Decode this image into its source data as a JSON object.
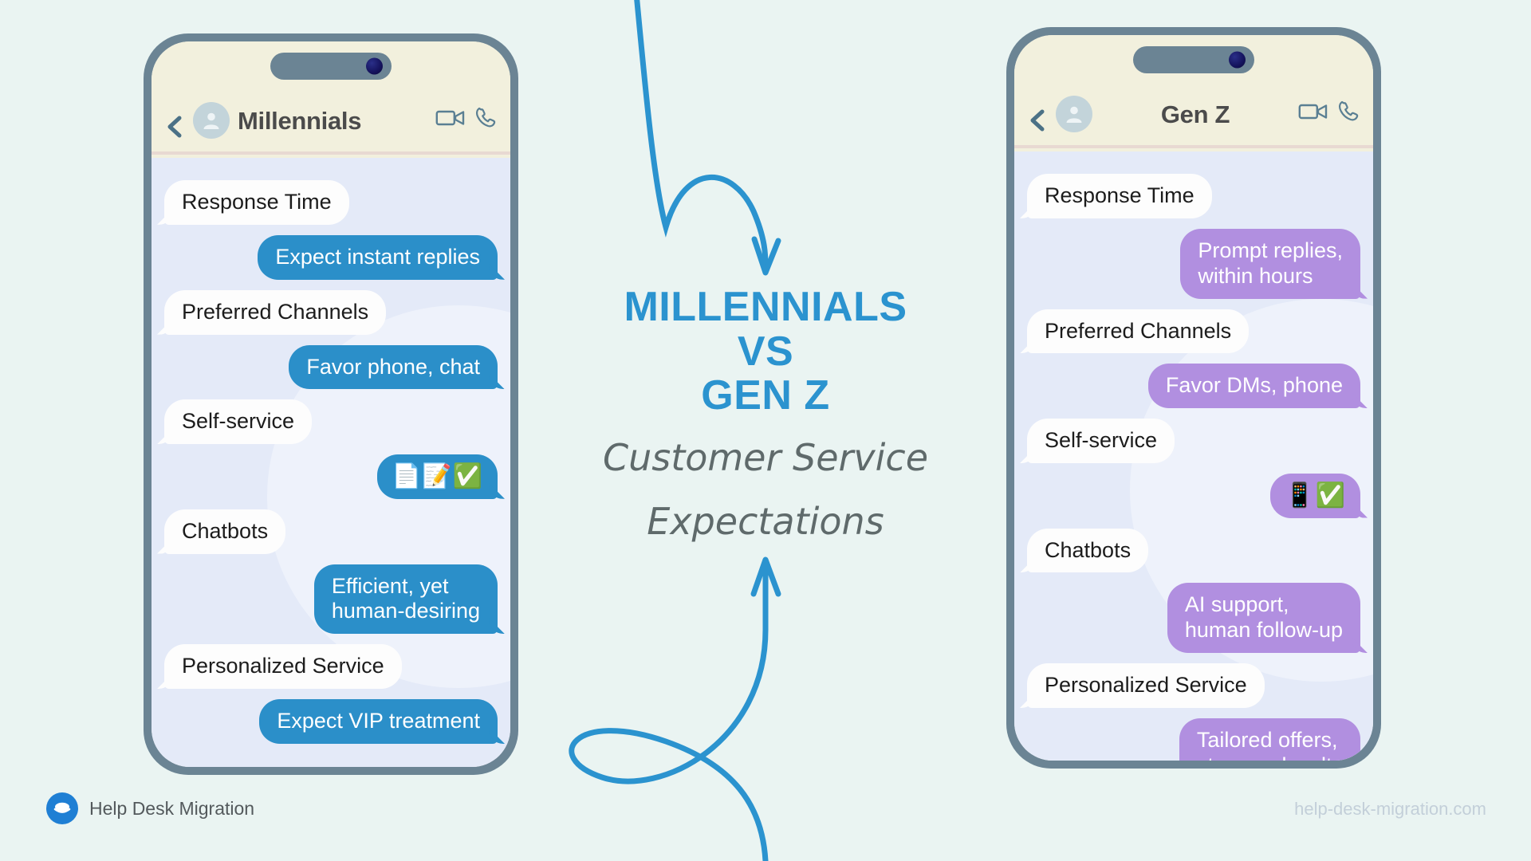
{
  "page": {
    "background_color": "#eaf4f2",
    "blue": "#2b8fc9",
    "purple": "#b18fe0"
  },
  "center": {
    "title_line1": "MILLENNIALS",
    "title_line2": "VS",
    "title_line3": "GEN Z",
    "subtitle_line1": "Customer Service",
    "subtitle_line2": "Expectations"
  },
  "phones": [
    {
      "id": "millennials",
      "header": {
        "back_icon": "chevron-left-icon",
        "avatar_icon": "person-avatar-icon",
        "title": "Millennials",
        "video_icon": "video-camera-icon",
        "call_icon": "phone-handset-icon"
      },
      "messages": [
        {
          "side": "left",
          "style": "white",
          "text": "Response Time"
        },
        {
          "side": "right",
          "style": "blue",
          "text": "Expect instant replies"
        },
        {
          "side": "left",
          "style": "white",
          "text": "Preferred Channels"
        },
        {
          "side": "right",
          "style": "blue",
          "text": "Favor phone, chat"
        },
        {
          "side": "left",
          "style": "white",
          "text": "Self-service"
        },
        {
          "side": "right",
          "style": "blue emoji",
          "text": "📄📝✅"
        },
        {
          "side": "left",
          "style": "white",
          "text": "Chatbots"
        },
        {
          "side": "right",
          "style": "blue",
          "text": "Efficient, yet\nhuman-desiring"
        },
        {
          "side": "left",
          "style": "white",
          "text": "Personalized Service"
        },
        {
          "side": "right",
          "style": "blue",
          "text": "Expect VIP treatment"
        }
      ]
    },
    {
      "id": "genz",
      "header": {
        "back_icon": "chevron-left-icon",
        "avatar_icon": "person-avatar-icon",
        "title": "Gen Z",
        "video_icon": "video-camera-icon",
        "call_icon": "phone-handset-icon"
      },
      "messages": [
        {
          "side": "left",
          "style": "white",
          "text": "Response Time"
        },
        {
          "side": "right",
          "style": "purple",
          "text": "Prompt replies,\nwithin hours"
        },
        {
          "side": "left",
          "style": "white",
          "text": "Preferred Channels"
        },
        {
          "side": "right",
          "style": "purple",
          "text": "Favor DMs, phone"
        },
        {
          "side": "left",
          "style": "white",
          "text": "Self-service"
        },
        {
          "side": "right",
          "style": "purple emoji",
          "text": "📱✅"
        },
        {
          "side": "left",
          "style": "white",
          "text": "Chatbots"
        },
        {
          "side": "right",
          "style": "purple",
          "text": "AI support,\nhuman follow-up"
        },
        {
          "side": "left",
          "style": "white",
          "text": "Personalized Service"
        },
        {
          "side": "right",
          "style": "purple",
          "text": "Tailored offers,\nstronger loyalty"
        }
      ]
    }
  ],
  "footer": {
    "brand": "Help Desk Migration",
    "url": "help-desk-migration.com"
  }
}
